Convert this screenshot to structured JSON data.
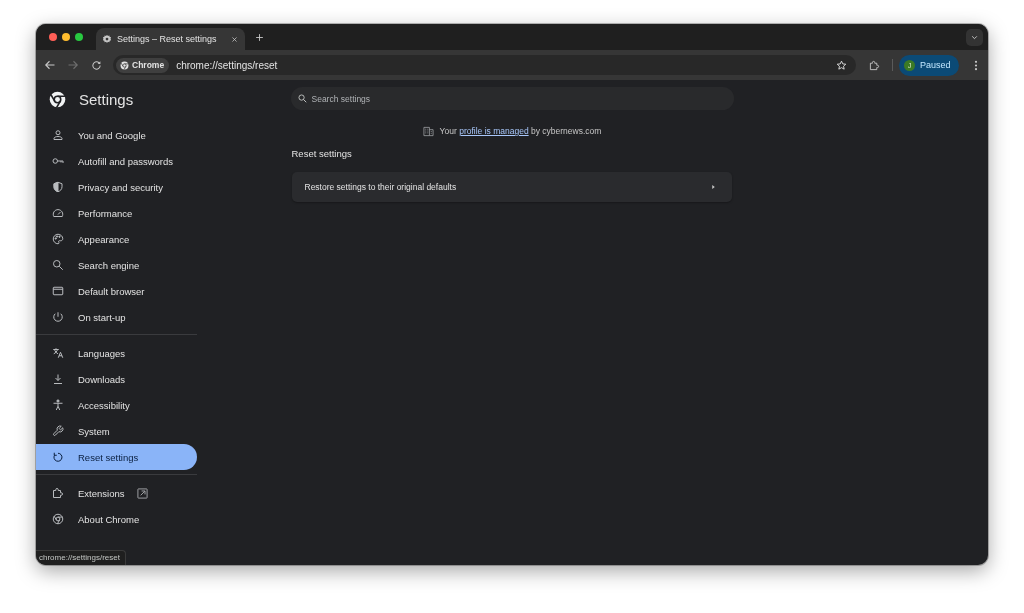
{
  "window": {
    "tabs": [
      {
        "title": "Settings – Reset settings",
        "selected": true
      }
    ]
  },
  "toolbar": {
    "forward_disabled": true,
    "site_chip": "Chrome",
    "address": "chrome://settings/reset",
    "profile": {
      "initial": "J",
      "label": "Paused"
    }
  },
  "sidebar": {
    "title": "Settings",
    "groups": [
      {
        "items": [
          {
            "label": "You and Google",
            "selected": false
          },
          {
            "label": "Autofill and passwords",
            "selected": false
          },
          {
            "label": "Privacy and security",
            "selected": false
          },
          {
            "label": "Performance",
            "selected": false
          },
          {
            "label": "Appearance",
            "selected": false
          },
          {
            "label": "Search engine",
            "selected": false
          },
          {
            "label": "Default browser",
            "selected": false
          },
          {
            "label": "On start-up",
            "selected": false
          }
        ]
      },
      {
        "items": [
          {
            "label": "Languages",
            "selected": false
          },
          {
            "label": "Downloads",
            "selected": false
          },
          {
            "label": "Accessibility",
            "selected": false
          },
          {
            "label": "System",
            "selected": false
          },
          {
            "label": "Reset settings",
            "selected": true
          }
        ]
      },
      {
        "items": [
          {
            "label": "Extensions",
            "selected": false,
            "external": true
          },
          {
            "label": "About Chrome",
            "selected": false,
            "external": false
          }
        ]
      }
    ]
  },
  "search": {
    "placeholder": "Search settings"
  },
  "managed_notice": {
    "before": "Your",
    "link": "profile is managed",
    "after": "by cybernews.com"
  },
  "section": {
    "title": "Reset settings",
    "rows": [
      {
        "label": "Restore settings to their original defaults"
      }
    ]
  },
  "status_bubble": "chrome://settings/reset"
}
